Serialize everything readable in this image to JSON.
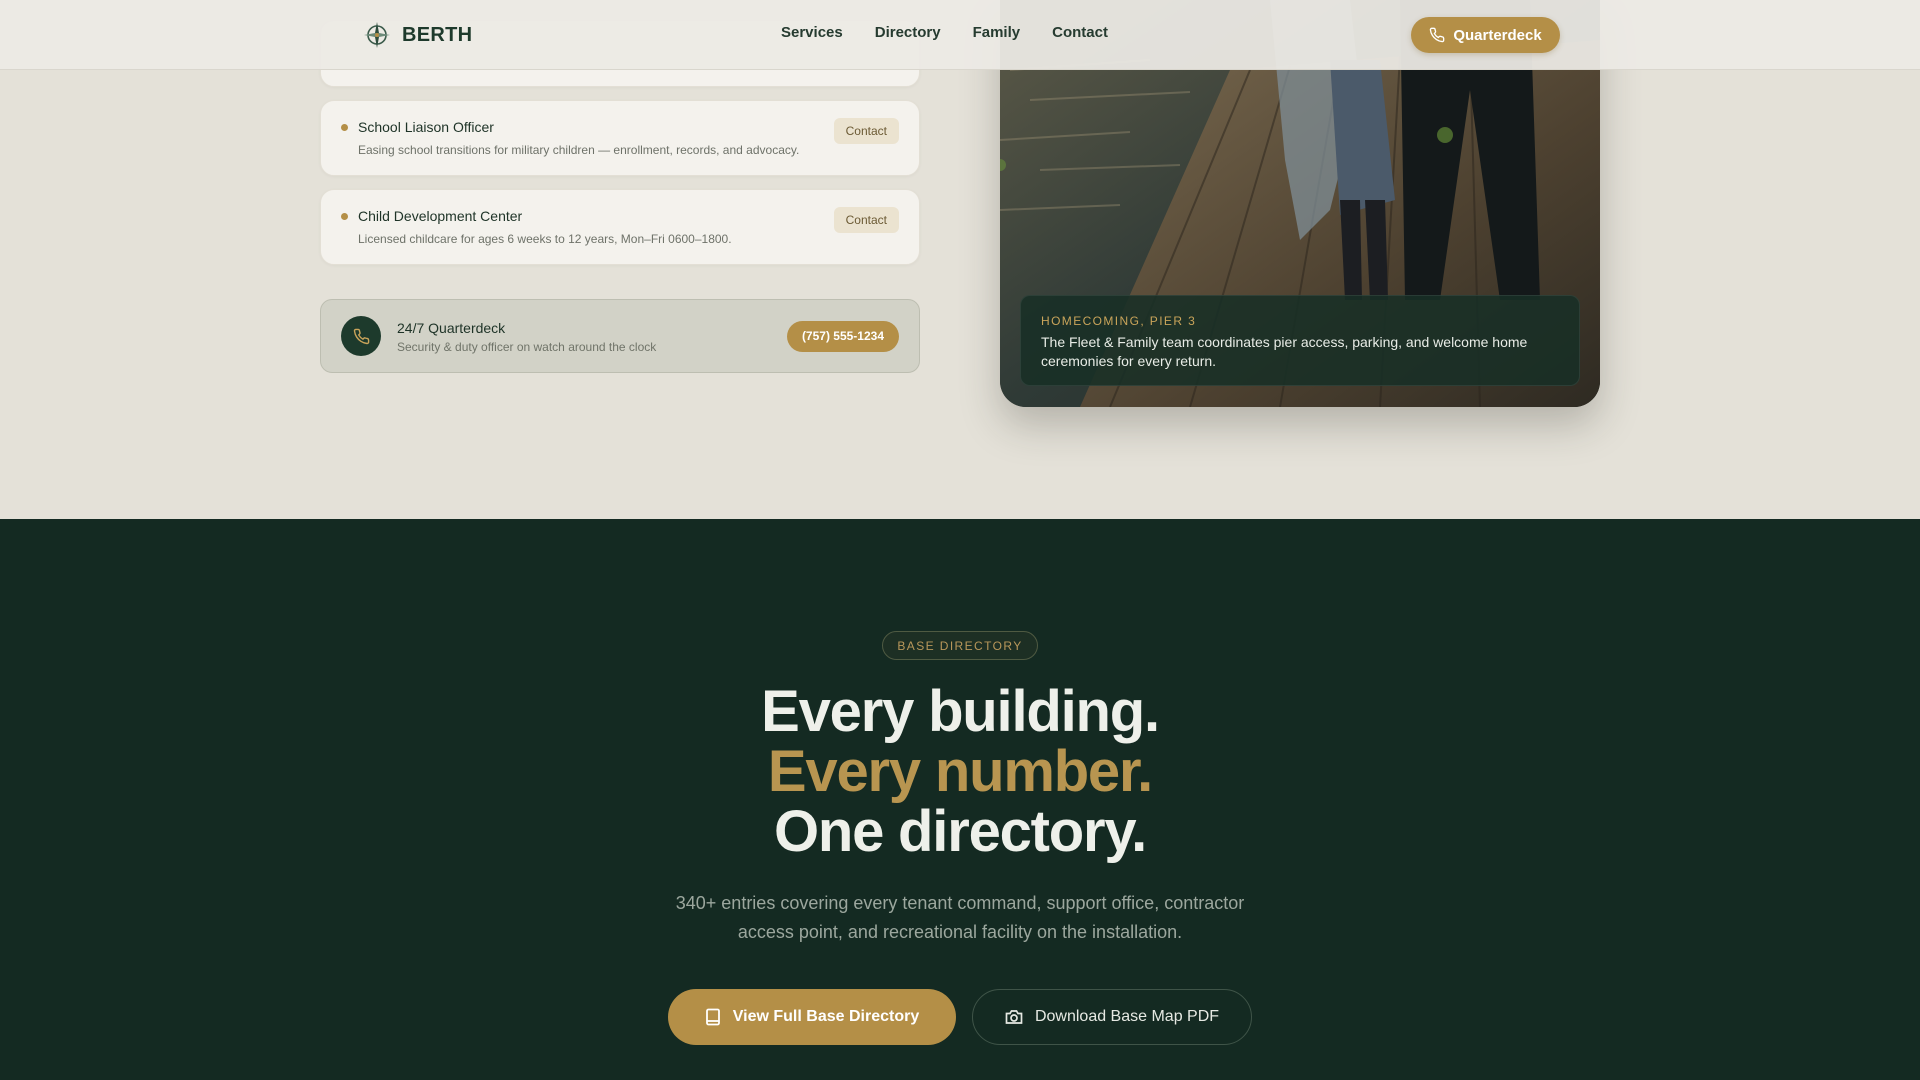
{
  "header": {
    "brand": "BERTH",
    "nav": [
      {
        "label": "Services"
      },
      {
        "label": "Directory"
      },
      {
        "label": "Family"
      },
      {
        "label": "Contact"
      }
    ],
    "cta_label": "Quarterdeck"
  },
  "contacts": [
    {
      "title": "School Liaison Officer",
      "description": "Easing school transitions for military children — enrollment, records, and advocacy.",
      "action": "Contact"
    },
    {
      "title": "Child Development Center",
      "description": "Licensed childcare for ages 6 weeks to 12 years, Mon–Fri 0600–1800.",
      "action": "Contact"
    }
  ],
  "quarterdeck": {
    "title": "24/7 Quarterdeck",
    "subtitle": "Security & duty officer on watch around the clock",
    "phone": "(757) 555-1234"
  },
  "photo_caption": {
    "tag": "HOMECOMING, PIER 3",
    "text": "The Fleet & Family team coordinates pier access, parking, and welcome home ceremonies for every return."
  },
  "directory": {
    "tag": "BASE DIRECTORY",
    "headline": [
      "Every building.",
      "Every number.",
      "One directory."
    ],
    "subcopy": "340+ entries covering every tenant command, support office, contractor access point, and recreational facility on the installation.",
    "primary_button": "View Full Base Directory",
    "secondary_button": "Download Base Map PDF"
  },
  "colors": {
    "accent_gold": "#b48f47",
    "dark_green": "#142a22",
    "page_bg": "#e4e1d8"
  }
}
